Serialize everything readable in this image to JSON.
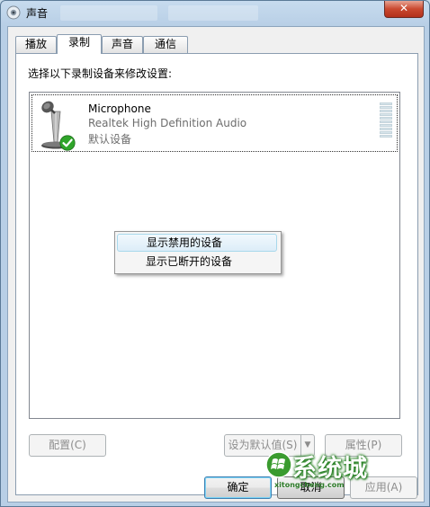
{
  "window": {
    "title": "声音",
    "close_glyph": "✕"
  },
  "tabs": [
    {
      "label": "播放"
    },
    {
      "label": "录制"
    },
    {
      "label": "声音"
    },
    {
      "label": "通信"
    }
  ],
  "active_tab": "录制",
  "panel": {
    "instruction": "选择以下录制设备来修改设置:"
  },
  "device": {
    "name": "Microphone",
    "driver": "Realtek High Definition Audio",
    "status": "默认设备",
    "icon": "microphone-icon",
    "badge_icon": "green-check-icon",
    "level": 0
  },
  "context_menu": {
    "items": [
      {
        "label": "显示禁用的设备",
        "hovered": true
      },
      {
        "label": "显示已断开的设备",
        "hovered": false
      }
    ]
  },
  "buttons": {
    "configure": "配置(C)",
    "set_default": "设为默认值(S)",
    "properties": "属性(P)",
    "ok": "确定",
    "cancel": "取消",
    "apply": "应用(A)"
  },
  "watermark": {
    "text": "系统城",
    "url": "xitongcheng.com"
  },
  "colors": {
    "accent": "#3c7fb1",
    "hover": "#dcedf8",
    "check": "#2fa52a"
  }
}
